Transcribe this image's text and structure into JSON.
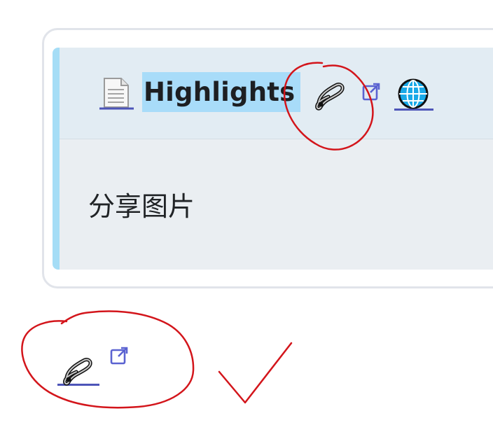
{
  "card": {
    "title": "Highlights",
    "body": "分享图片"
  },
  "icons": {
    "doc": "document-icon",
    "pin": "safety-pin-icon",
    "external": "external-link-icon",
    "globe": "globe-icon"
  },
  "colors": {
    "highlight": "#a8dcf9",
    "accent_bar": "#a5ddf6",
    "link_underline": "#4d55b8",
    "annotation_red": "#d3151b",
    "external_icon": "#5b63d1"
  }
}
